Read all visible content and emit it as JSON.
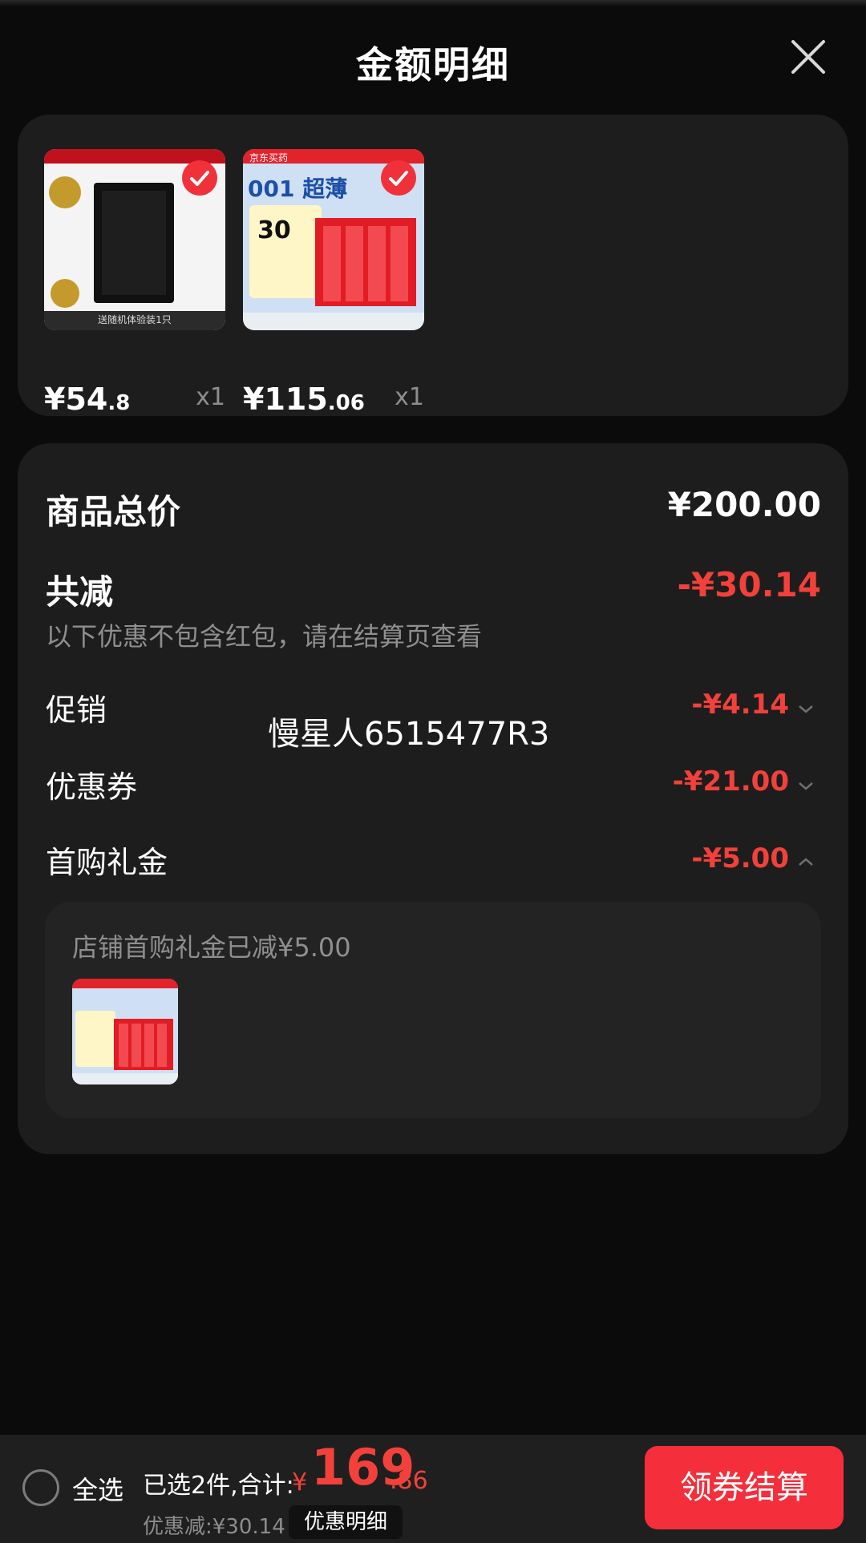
{
  "header": {
    "title": "金额明细"
  },
  "products": [
    {
      "price_int": "¥54",
      "price_dec": ".8",
      "qty": "x1",
      "thumb_caption": "送随机体验装1只"
    },
    {
      "price_int": "¥115",
      "price_dec": ".06",
      "qty": "x1",
      "thumb_brand": "京东买药",
      "thumb_headline": "001 超薄",
      "thumb_badge": "30"
    }
  ],
  "summary": {
    "total_label": "商品总价",
    "total_value": "¥200.00",
    "reduce_label": "共减",
    "reduce_value": "-¥30.14",
    "reduce_note": "以下优惠不包含红包，请在结算页查看",
    "promo_label": "促销",
    "promo_value": "-¥4.14",
    "watermark": "慢星人6515477R3",
    "coupon_label": "优惠券",
    "coupon_value": "-¥21.00",
    "gift_label": "首购礼金",
    "gift_value": "-¥5.00",
    "gift_note": "店铺首购礼金已减¥5.00"
  },
  "bottom_bar": {
    "select_all": "全选",
    "selected_info": "已选2件,合计:",
    "total_symbol": "¥",
    "total_int": "169",
    "total_dec": ".86",
    "discount_info": "优惠减:¥30.14",
    "detail_button": "优惠明细",
    "checkout_button": "领券结算"
  },
  "colors": {
    "accent": "#f2413b",
    "background": "#0b0b0b",
    "card": "#1d1d1d"
  },
  "icons": [
    "close-icon",
    "check-icon",
    "chevron-down-icon",
    "chevron-up-icon",
    "radio-icon"
  ]
}
